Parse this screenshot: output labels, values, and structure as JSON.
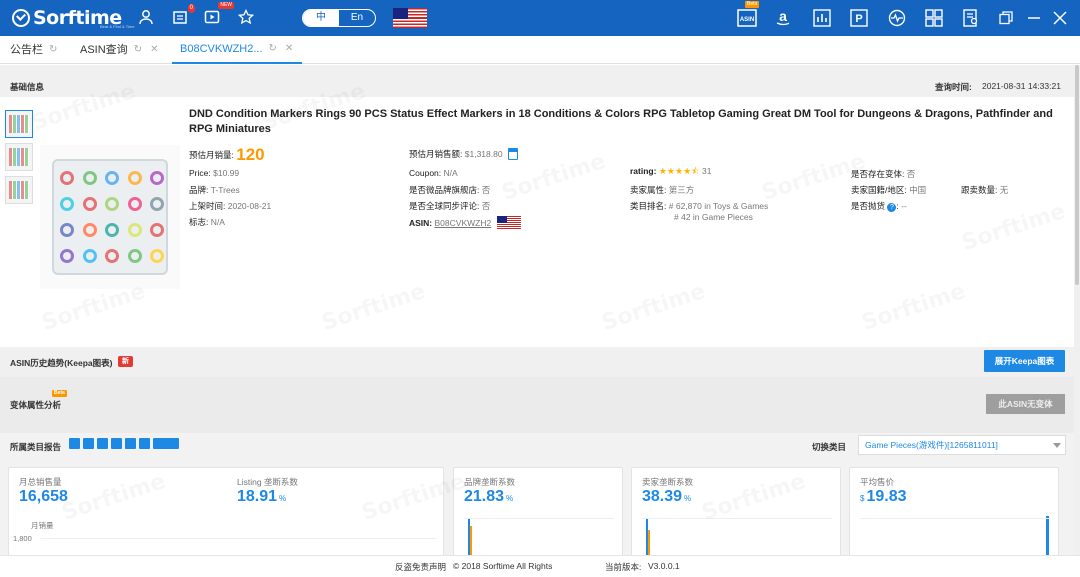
{
  "app": {
    "logo": "Sorftime",
    "logo_sub": "Beat & Find & Time",
    "notification_count": "0",
    "new_tag": "NEW",
    "beta_tag": "Beta",
    "lang": {
      "zh": "中",
      "en": "En"
    },
    "right_icons": [
      "asin-icon",
      "amazon-icon",
      "chart-icon",
      "parking-icon",
      "pulse-icon",
      "grid-icon",
      "report-icon",
      "restore-icon",
      "minimize-icon",
      "close-icon"
    ]
  },
  "tabs": [
    {
      "label": "公告栏"
    },
    {
      "label": "ASIN查询"
    },
    {
      "label": "B08CVKWZH2..."
    }
  ],
  "basic": {
    "section_title": "基础信息",
    "query_time_label": "查询时间:",
    "query_time": "2021-08-31 14:33:21",
    "product_title": "DND Condition Markers Rings 90 PCS Status Effect Markers in 18 Conditions & Colors RPG Tabletop Gaming Great DM Tool for Dungeons & Dragons, Pathfinder and RPG Miniatures",
    "monthly_sales_label": "预估月销量:",
    "monthly_sales": "120",
    "monthly_revenue_label": "预估月销售额:",
    "monthly_revenue": "$1,318.80",
    "price_label": "Price:",
    "price": "$10.99",
    "coupon_label": "Coupon:",
    "coupon": "N/A",
    "rating_label": "rating:",
    "rating_value": 4.5,
    "rating_count": "31",
    "variant_exists_label": "是否存在变体:",
    "variant_exists": "否",
    "brand_label": "品牌:",
    "brand": "T-Trees",
    "flagship_label": "是否微品牌旗舰店:",
    "flagship": "否",
    "seller_attr_label": "卖家属性:",
    "seller_attr": "第三方",
    "seller_region_label": "卖家国籍/地区:",
    "seller_region": "中国",
    "follow_count_label": "跟卖数量:",
    "follow_count": "无",
    "listed_label": "上架时间:",
    "listed": "2020-08-21",
    "global_review_label": "是否全球同步评论:",
    "global_review": "否",
    "rank_label": "类目排名:",
    "rank_1": "# 62,870 in Toys & Games",
    "rank_2": "# 42 in Game Pieces",
    "thrown_label": "是否抛货",
    "thrown": "--",
    "tag_label": "标志:",
    "tag": "N/A",
    "asin_label": "ASIN:",
    "asin": "B08CVKWZH2"
  },
  "keepa": {
    "title": "ASIN历史趋势(Keepa图表)",
    "new_tag": "新",
    "button": "展开Keepa图表"
  },
  "variant": {
    "title": "变体属性分析",
    "beta_tag": "Beta",
    "button": "此ASIN无变体"
  },
  "category": {
    "title": "所属类目报告",
    "switch_label": "切换类目",
    "selected": "Game Pieces(游戏件)[1265811011]"
  },
  "stats": [
    {
      "label": "月总销售量",
      "value": "16,658",
      "unit": ""
    },
    {
      "label": "Listing 垄断系数",
      "value": "18.91",
      "unit": "%"
    },
    {
      "label": "品牌垄断系数",
      "value": "21.83",
      "unit": "%"
    },
    {
      "label": "卖家垄断系数",
      "value": "38.39",
      "unit": "%"
    },
    {
      "label": "平均售价",
      "value": "19.83",
      "unit": "$"
    }
  ],
  "mini_chart": {
    "label": "月销量",
    "tick": "1,800"
  },
  "footer": {
    "disclaimer": "反盗免责声明",
    "copyright": "© 2018 Sorftime All Rights",
    "version_label": "当前版本:",
    "version": "V3.0.0.1"
  },
  "watermark": "Sorftime"
}
